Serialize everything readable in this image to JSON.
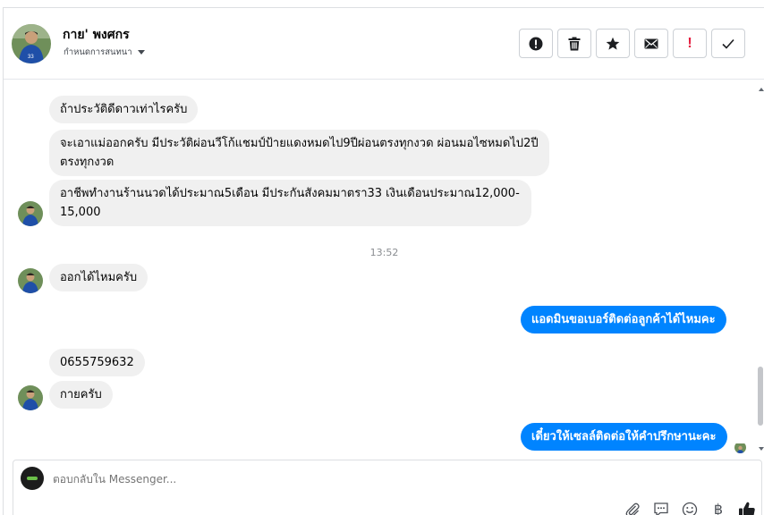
{
  "header": {
    "contact_name": "กาย' พงศกร",
    "assign_label": "กำหนดการสนทนา",
    "actions": [
      {
        "icon": "alert-circle-icon"
      },
      {
        "icon": "trash-icon"
      },
      {
        "icon": "star-icon"
      },
      {
        "icon": "envelope-icon"
      },
      {
        "icon": "exclamation-icon",
        "text": "!"
      },
      {
        "icon": "checkmark-icon"
      }
    ]
  },
  "conversation": {
    "messages": [
      {
        "side": "in",
        "text": "ถ้าประวัติดีดาวเท่าไรครับ"
      },
      {
        "side": "in",
        "text": "จะเอาแม่ออกครับ มีประวัติผ่อนวีโก้แชมป์ป้ายแดงหมดไป9ปีผ่อนตรงทุกงวด ผ่อนมอไซหมดไป2ปีตรงทุกงวด"
      },
      {
        "side": "in",
        "text": "อาชีพทำงานร้านนวดได้ประมาณ5เดือน มีประกันสังคมมาตรา33 เงินเดือนประมาณ12,000-15,000"
      },
      {
        "side": "in",
        "text": "ออกได้ไหมครับ"
      },
      {
        "side": "out",
        "text": "แอดมินขอเบอร์ติดต่อลูกค้าได้ไหมคะ"
      },
      {
        "side": "in",
        "text": "0655759632"
      },
      {
        "side": "in",
        "text": "กายครับ"
      },
      {
        "side": "out",
        "text": "เดี๋ยวให้เซลล์ติดต่อให้คำปรึกษานะคะ"
      }
    ],
    "timestamp": "13:52"
  },
  "composer": {
    "placeholder": "ตอบกลับใน Messenger...",
    "tools": [
      "paperclip-icon",
      "speech-bubble-icon",
      "smiley-icon",
      "baht-icon",
      "thumbs-up-icon"
    ],
    "baht_symbol": "฿"
  },
  "colors": {
    "outgoing_bubble": "#0084ff",
    "incoming_bubble": "#f0f0f0",
    "danger": "#e41e3f"
  }
}
